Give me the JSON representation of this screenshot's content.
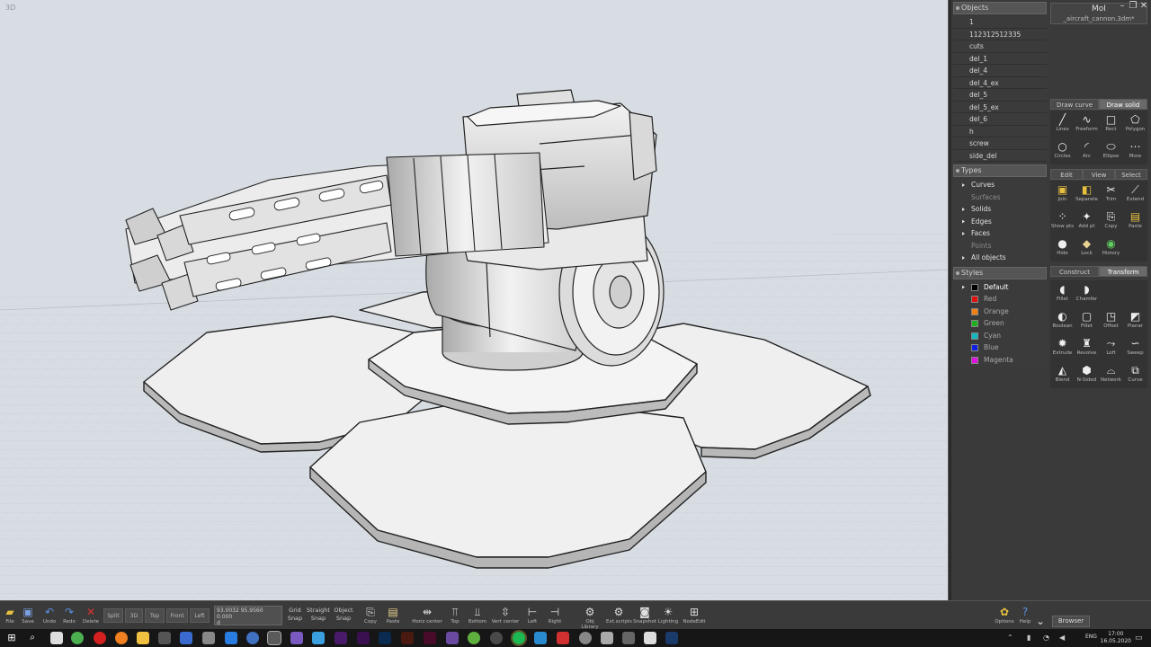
{
  "viewport": {
    "label": "3D"
  },
  "objects_panel": {
    "title": "Objects",
    "items": [
      "1",
      "112312512335",
      "cuts",
      "del_1",
      "del_4",
      "del_4_ex",
      "del_5",
      "del_5_ex",
      "del_6",
      "h",
      "screw",
      "side_del"
    ]
  },
  "types_panel": {
    "title": "Types",
    "items": [
      {
        "label": "Curves",
        "enabled": true
      },
      {
        "label": "Surfaces",
        "enabled": false
      },
      {
        "label": "Solids",
        "enabled": true
      },
      {
        "label": "Edges",
        "enabled": true
      },
      {
        "label": "Faces",
        "enabled": true
      },
      {
        "label": "Points",
        "enabled": false
      },
      {
        "label": "All objects",
        "enabled": true
      }
    ]
  },
  "styles_panel": {
    "title": "Styles",
    "items": [
      {
        "label": "Default",
        "color": "#000000"
      },
      {
        "label": "Red",
        "color": "#e01010"
      },
      {
        "label": "Orange",
        "color": "#f08010"
      },
      {
        "label": "Green",
        "color": "#20b020"
      },
      {
        "label": "Cyan",
        "color": "#10b8c0"
      },
      {
        "label": "Blue",
        "color": "#1020e0"
      },
      {
        "label": "Magenta",
        "color": "#e010e0"
      }
    ]
  },
  "app": {
    "name": "MoI",
    "file": "_aircraft_cannon.3dm*"
  },
  "draw_tabs": [
    "Draw curve",
    "Draw solid"
  ],
  "draw_tools": [
    {
      "label": "Lines",
      "icon": "line-icon"
    },
    {
      "label": "Freeform",
      "icon": "freeform-icon"
    },
    {
      "label": "Rect",
      "icon": "rect-icon"
    },
    {
      "label": "Polygon",
      "icon": "polygon-icon"
    },
    {
      "label": "Circles",
      "icon": "circle-icon"
    },
    {
      "label": "Arc",
      "icon": "arc-icon"
    },
    {
      "label": "Ellipse",
      "icon": "ellipse-icon"
    },
    {
      "label": "More",
      "icon": "more-icon"
    }
  ],
  "edit_tabs": [
    "Edit",
    "View",
    "Select"
  ],
  "edit_tools": [
    {
      "label": "Join",
      "icon": "join-icon"
    },
    {
      "label": "Separate",
      "icon": "separate-icon"
    },
    {
      "label": "Trim",
      "icon": "trim-icon"
    },
    {
      "label": "Extend",
      "icon": "extend-icon"
    },
    {
      "label": "Show pts",
      "icon": "show-points-icon"
    },
    {
      "label": "Add pt",
      "icon": "add-point-icon"
    },
    {
      "label": "Copy",
      "icon": "copy-icon"
    },
    {
      "label": "Paste",
      "icon": "paste-icon"
    },
    {
      "label": "Hide",
      "icon": "hide-icon"
    },
    {
      "label": "Lock",
      "icon": "lock-icon"
    },
    {
      "label": "History",
      "icon": "history-icon"
    }
  ],
  "construct_tabs": [
    "Construct",
    "Transform"
  ],
  "construct_tools": [
    {
      "label": "Fillet",
      "icon": "fillet-icon"
    },
    {
      "label": "Chamfer",
      "icon": "chamfer-icon"
    },
    {
      "label": "",
      "icon": ""
    },
    {
      "label": "",
      "icon": ""
    },
    {
      "label": "Boolean",
      "icon": "boolean-icon"
    },
    {
      "label": "Fillet",
      "icon": "fillet-icon"
    },
    {
      "label": "Offset",
      "icon": "offset-icon"
    },
    {
      "label": "Planar",
      "icon": "planar-icon"
    },
    {
      "label": "Extrude",
      "icon": "extrude-icon"
    },
    {
      "label": "Revolve",
      "icon": "revolve-icon"
    },
    {
      "label": "Loft",
      "icon": "loft-icon"
    },
    {
      "label": "Sweep",
      "icon": "sweep-icon"
    },
    {
      "label": "Blend",
      "icon": "blend-icon"
    },
    {
      "label": "N-Sided",
      "icon": "nsided-icon"
    },
    {
      "label": "Network",
      "icon": "network-icon"
    },
    {
      "label": "Curve",
      "icon": "curve-icon"
    }
  ],
  "bottom_toolbar": {
    "file": "File",
    "save": "Save",
    "undo": "Undo",
    "redo": "Redo",
    "delete": "Delete",
    "views": [
      "Split",
      "3D",
      "Top",
      "Front",
      "Left"
    ],
    "coord_x": "93.0032",
    "coord_y": "95.9560",
    "coord_z": "0.000",
    "coord_d": "d",
    "grid_snap": [
      "Grid",
      "Snap"
    ],
    "straight_snap": [
      "Straight",
      "Snap"
    ],
    "object_snap": [
      "Object",
      "Snap"
    ],
    "copy": "Copy",
    "paste": "Paste",
    "align": [
      "Horiz center",
      "Top",
      "Bottom",
      "Vert center",
      "Left",
      "Right"
    ],
    "plugins": [
      "Obj Library",
      "Ext.scripts",
      "Snapshot",
      "Lighting",
      "NodeEdit"
    ],
    "options": "Options",
    "help": "Help",
    "browser": "Browser"
  },
  "taskbar": {
    "time": "17:00",
    "date": "16.05.2020",
    "lang": "ENG"
  },
  "colors": {
    "viewport_bg": "#d7dde3",
    "panel_bg": "#3a3a3a",
    "accent": "#6a6a6a"
  }
}
